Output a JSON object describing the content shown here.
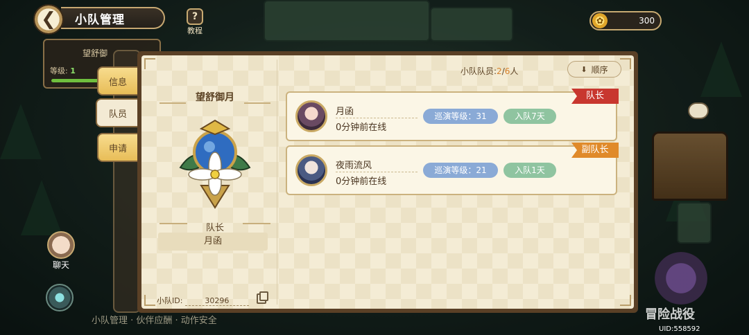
{
  "header": {
    "title": "小队管理",
    "tutorial_label": "教程",
    "tutorial_icon_text": "?",
    "coins": "300"
  },
  "background": {
    "behind_panel_name": "望舒御",
    "behind_panel_level_label": "等级:",
    "behind_panel_level_value": "1",
    "chat_label": "聊天",
    "adventure_label": "冒险战役",
    "uid": "UID:558592",
    "bottom_text": "小队管理 · 伙伴应酬 · 动作安全"
  },
  "tabs": [
    {
      "label": "信息"
    },
    {
      "label": "队员",
      "active": true
    },
    {
      "label": "申请"
    }
  ],
  "team": {
    "name": "望舒御月",
    "role_label": "队长",
    "leader_name": "月函",
    "id_label": "小队ID:",
    "id_value": "30296"
  },
  "members_header": {
    "label": "小队队员:",
    "current": "2",
    "separator": "/",
    "max": "6",
    "unit": "人",
    "order_label": "顺序"
  },
  "members": [
    {
      "name": "月函",
      "status": "0分钟前在线",
      "level_text": "巡演等级：31",
      "days_text": "入队7天",
      "role": "队长"
    },
    {
      "name": "夜雨流风",
      "status": "0分钟前在线",
      "level_text": "巡演等级：21",
      "days_text": "入队1天",
      "role": "副队长"
    }
  ],
  "colors": {
    "leader_ribbon": "#c8372f",
    "vice_ribbon": "#e08a2a",
    "level_pill": "#8aaad6",
    "days_pill": "#8fc4a0",
    "highlight": "#d9822b"
  }
}
